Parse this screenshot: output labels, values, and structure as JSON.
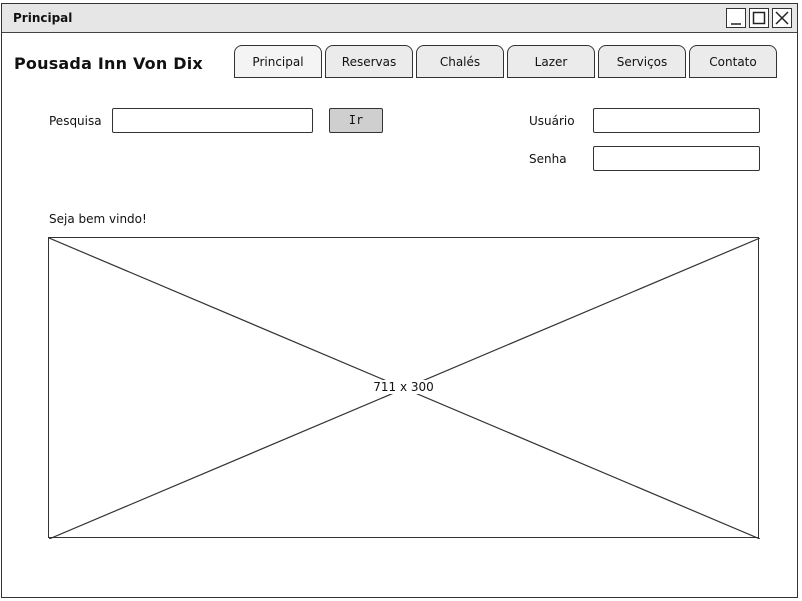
{
  "window": {
    "title": "Principal",
    "controls": {
      "minimize_icon": "minimize-icon",
      "maximize_icon": "maximize-icon",
      "close_icon": "close-icon"
    }
  },
  "brand": "Pousada Inn Von Dix",
  "nav": {
    "tabs": [
      {
        "label": "Principal"
      },
      {
        "label": "Reservas"
      },
      {
        "label": "Chalés"
      },
      {
        "label": "Lazer"
      },
      {
        "label": "Serviços"
      },
      {
        "label": "Contato"
      }
    ]
  },
  "search": {
    "label": "Pesquisa",
    "value": "",
    "button_label": "Ir"
  },
  "login": {
    "user_label": "Usuário",
    "user_value": "",
    "password_label": "Senha",
    "password_value": ""
  },
  "welcome": "Seja bem vindo!",
  "image": {
    "caption": "711 x 300"
  }
}
